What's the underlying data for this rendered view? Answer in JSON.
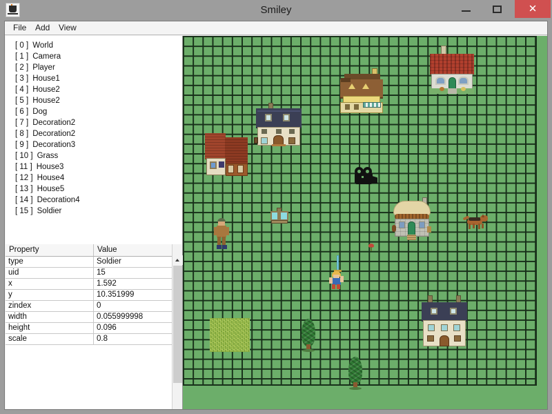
{
  "window": {
    "title": "Smiley",
    "app_icon": "java-cup-icon",
    "controls": {
      "minimize_label": "–",
      "maximize_label": "☐",
      "close_label": "✕"
    }
  },
  "menubar": {
    "items": [
      {
        "label": "File",
        "name": "menu-file"
      },
      {
        "label": "Add",
        "name": "menu-add"
      },
      {
        "label": "View",
        "name": "menu-view"
      }
    ]
  },
  "scene_tree": {
    "items": [
      {
        "index": "[ 0 ]",
        "name": "World"
      },
      {
        "index": "[ 1 ]",
        "name": "Camera"
      },
      {
        "index": "[ 2 ]",
        "name": "Player"
      },
      {
        "index": "[ 3 ]",
        "name": "House1"
      },
      {
        "index": "[ 4 ]",
        "name": "House2"
      },
      {
        "index": "[ 5 ]",
        "name": "House2"
      },
      {
        "index": "[ 6 ]",
        "name": "Dog"
      },
      {
        "index": "[ 7 ]",
        "name": "Decoration2"
      },
      {
        "index": "[ 8 ]",
        "name": "Decoration2"
      },
      {
        "index": "[ 9 ]",
        "name": "Decoration3"
      },
      {
        "index": "[ 10 ]",
        "name": "Grass"
      },
      {
        "index": "[ 11 ]",
        "name": "House3"
      },
      {
        "index": "[ 12 ]",
        "name": "House4"
      },
      {
        "index": "[ 13 ]",
        "name": "House5"
      },
      {
        "index": "[ 14 ]",
        "name": "Decoration4"
      },
      {
        "index": "[ 15 ]",
        "name": "Soldier"
      }
    ]
  },
  "property_table": {
    "columns": {
      "property": "Property",
      "value": "Value"
    },
    "rows": [
      {
        "key": "type",
        "value": "Soldier"
      },
      {
        "key": "uid",
        "value": "15"
      },
      {
        "key": "x",
        "value": "1.592"
      },
      {
        "key": "y",
        "value": "10.351999"
      },
      {
        "key": "zindex",
        "value": "0"
      },
      {
        "key": "width",
        "value": "0.055999998"
      },
      {
        "key": "height",
        "value": "0.096"
      },
      {
        "key": "scale",
        "value": "0.8"
      }
    ],
    "scrollbar": {
      "up_arrow": "chevron-up-icon"
    }
  },
  "canvas": {
    "background_color": "#6cae6a",
    "grid_line_color": "#18301a",
    "objects": [
      {
        "name": "house-blue-roof",
        "label": "House1"
      },
      {
        "name": "house-yellow-awning",
        "label": "House2"
      },
      {
        "name": "house-red-tile",
        "label": "House2"
      },
      {
        "name": "house-brown-double",
        "label": "House3"
      },
      {
        "name": "round-tower",
        "label": "House4"
      },
      {
        "name": "house-cream-bottom-right",
        "label": "House5"
      },
      {
        "name": "camera-object",
        "label": "Camera"
      },
      {
        "name": "player-sword",
        "label": "Player"
      },
      {
        "name": "soldier-unit",
        "label": "Soldier"
      },
      {
        "name": "dog-sprite",
        "label": "Dog"
      },
      {
        "name": "fountain-decoration",
        "label": "Decoration2"
      },
      {
        "name": "tree-decoration-1",
        "label": "Decoration3"
      },
      {
        "name": "tree-decoration-2",
        "label": "Decoration4"
      },
      {
        "name": "grass-patch",
        "label": "Grass"
      },
      {
        "name": "small-plant-decoration",
        "label": "Decoration2"
      }
    ]
  },
  "colors": {
    "title_bar": "#9d9d9d",
    "close_button": "#d05050",
    "panel_background": "#ffffff",
    "grass": "#6cae6a"
  }
}
